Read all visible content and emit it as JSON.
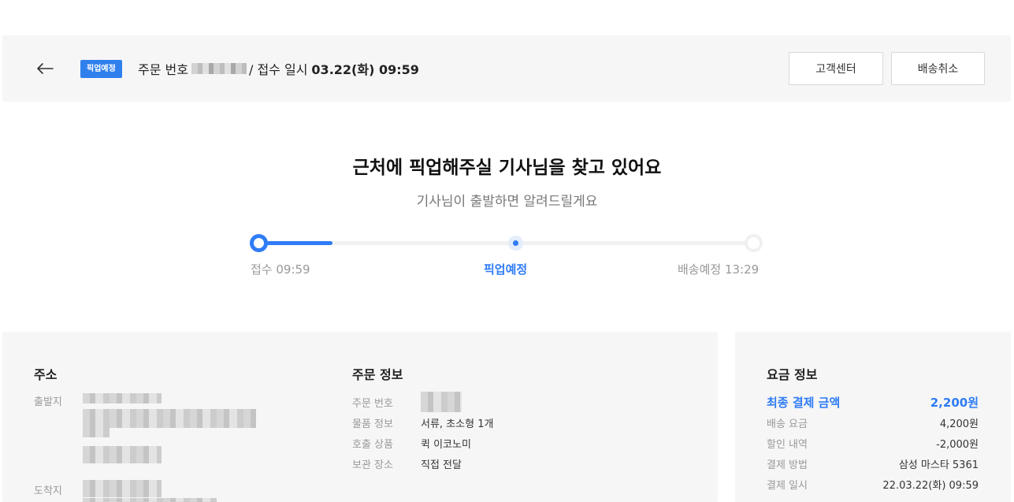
{
  "header": {
    "badge": "픽업예정",
    "order_no_label": "주문 번호",
    "separator": "/ 접수 일시",
    "received_at": "03.22(화) 09:59",
    "cs_button": "고객센터",
    "cancel_button": "배송취소"
  },
  "status": {
    "title": "근처에 픽업해주실 기사님을 찾고 있어요",
    "subtitle": "기사님이 출발하면 알려드릴게요",
    "progress_fraction": 0.15,
    "steps": [
      {
        "label": "접수 09:59"
      },
      {
        "label": "픽업예정"
      },
      {
        "label": "배송예정 13:29"
      }
    ]
  },
  "address": {
    "title": "주소",
    "origin_label": "출발지",
    "destination_label": "도착지"
  },
  "order_info": {
    "title": "주문 정보",
    "rows": [
      {
        "label": "주문 번호",
        "value": ""
      },
      {
        "label": "물품 정보",
        "value": "서류, 초소형 1개"
      },
      {
        "label": "호출 상품",
        "value": "퀵 이코노미"
      },
      {
        "label": "보관 장소",
        "value": "직접 전달"
      }
    ]
  },
  "fee_info": {
    "title": "요금 정보",
    "total_label": "최종 결제 금액",
    "total_value": "2,200원",
    "rows": [
      {
        "label": "배송 요금",
        "value": "4,200원"
      },
      {
        "label": "할인 내역",
        "value": "-2,000원"
      },
      {
        "label": "결제 방법",
        "value": "삼성 마스타 5361"
      },
      {
        "label": "결제 일시",
        "value": "22.03.22(화) 09:59"
      }
    ]
  },
  "colors": {
    "accent": "#2f7cf6",
    "panel": "#f6f6f6"
  }
}
